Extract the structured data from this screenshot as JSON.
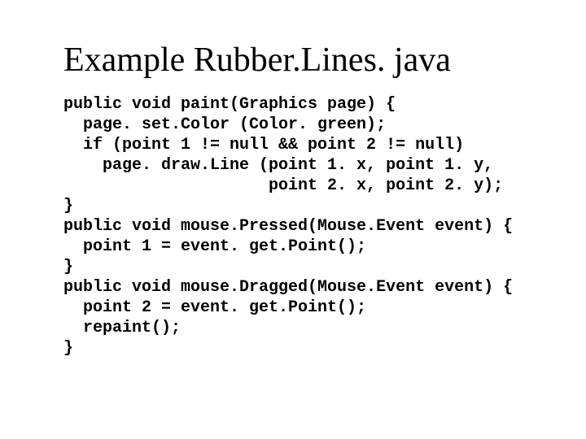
{
  "title": "Example Rubber.Lines. java",
  "code": {
    "l1": "public void paint(Graphics page) {",
    "l2": "  page. set.Color (Color. green);",
    "l3": "  if (point 1 != null && point 2 != null)",
    "l4": "    page. draw.Line (point 1. x, point 1. y,",
    "l5": "                     point 2. x, point 2. y);",
    "l6": "}",
    "l7": "public void mouse.Pressed(Mouse.Event event) {",
    "l8": "  point 1 = event. get.Point();",
    "l9": "}",
    "l10": "public void mouse.Dragged(Mouse.Event event) {",
    "l11": "  point 2 = event. get.Point();",
    "l12": "  repaint();",
    "l13": "}"
  }
}
